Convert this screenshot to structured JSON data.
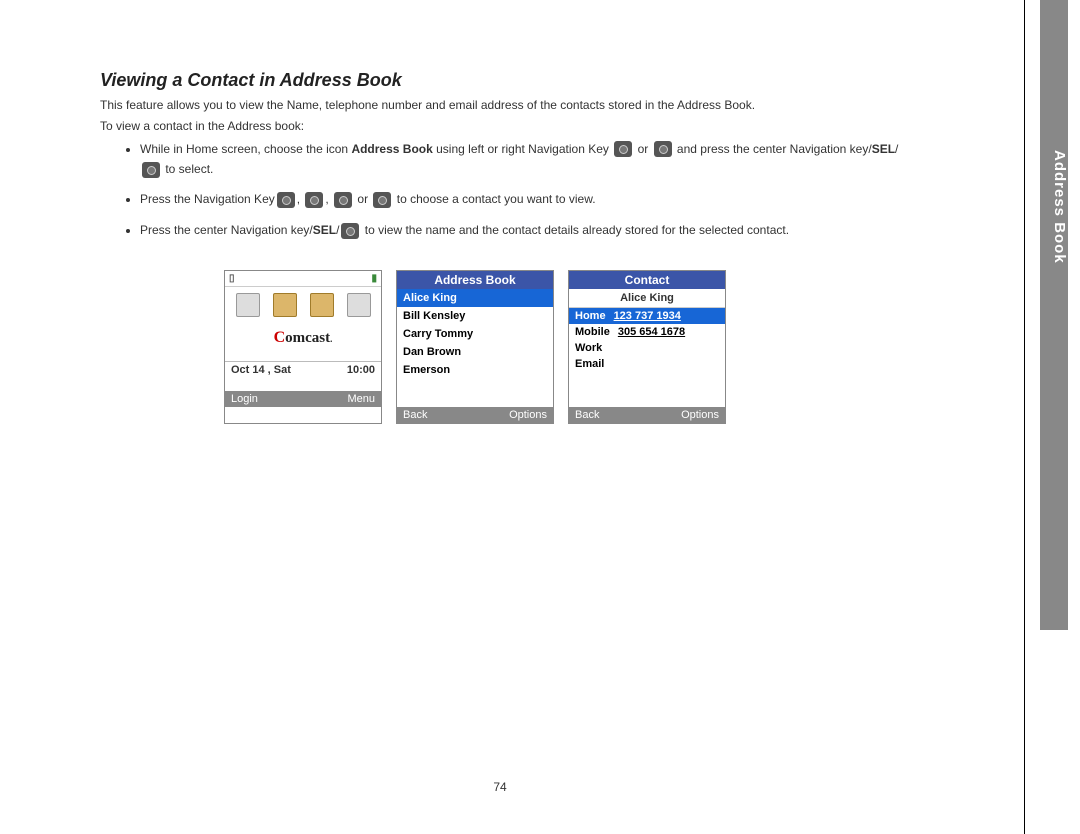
{
  "sideTab": "Address Book",
  "title": "Viewing a Contact in Address Book",
  "intro1": "This feature allows you to view the Name, telephone number and email address of the contacts stored in the Address Book.",
  "intro2": "To view a contact in the Address book:",
  "steps": {
    "s1a": "While in Home screen, choose the icon ",
    "s1b": "Address Book",
    "s1c": " using left or right Navigation Key ",
    "s1d": " or ",
    "s1e": "  and press the center Navigation key/",
    "s1f": "SEL",
    "s1g": "/",
    "s1h": " to select.",
    "s2a": "Press the Navigation Key",
    "s2b": ", ",
    "s2c": ", ",
    "s2d": " or ",
    "s2e": "  to choose a contact you want to view.",
    "s3a": "Press the center Navigation key/",
    "s3b": "SEL",
    "s3c": "/",
    "s3d": "  to view the name and the contact details already stored for the selected contact."
  },
  "homeScreen": {
    "brand": "omcast",
    "brandC": "C",
    "date": "Oct 14 , Sat",
    "time": "10:00",
    "softLeft": "Login",
    "softRight": "Menu"
  },
  "addressBookScreen": {
    "title": "Address Book",
    "items": [
      "Alice King",
      "Bill Kensley",
      "Carry Tommy",
      "Dan Brown",
      "Emerson"
    ],
    "softLeft": "Back",
    "softRight": "Options"
  },
  "contactScreen": {
    "title": "Contact",
    "name": "Alice King",
    "rows": [
      {
        "label": "Home",
        "value": "123 737 1934",
        "sel": true
      },
      {
        "label": "Mobile",
        "value": "305 654 1678",
        "sel": false
      },
      {
        "label": "Work",
        "value": "",
        "sel": false
      },
      {
        "label": "Email",
        "value": "",
        "sel": false
      }
    ],
    "softLeft": "Back",
    "softRight": "Options"
  },
  "pageNumber": "74"
}
